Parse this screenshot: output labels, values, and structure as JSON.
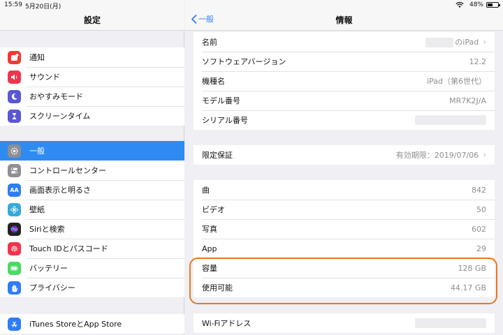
{
  "status": {
    "time": "15:59",
    "date": "5月20日(月)",
    "battery_pct": "48%",
    "battery_level": 0.48
  },
  "sidebar": {
    "title": "設定",
    "groups": [
      [
        {
          "label": "通知",
          "icon": "notifications-icon",
          "color": "#f03b32"
        },
        {
          "label": "サウンド",
          "icon": "sound-icon",
          "color": "#f0344d"
        },
        {
          "label": "おやすみモード",
          "icon": "moon-icon",
          "color": "#5a56d6"
        },
        {
          "label": "スクリーンタイム",
          "icon": "hourglass-icon",
          "color": "#5a56d6"
        }
      ],
      [
        {
          "label": "一般",
          "icon": "gear-icon",
          "color": "#8e8e93",
          "selected": true
        },
        {
          "label": "コントロールセンター",
          "icon": "toggles-icon",
          "color": "#8e8e93"
        },
        {
          "label": "画面表示と明るさ",
          "icon": "text-size-icon",
          "color": "#2f7cf6",
          "glyph": "AA"
        },
        {
          "label": "壁紙",
          "icon": "wallpaper-icon",
          "color": "#35aadc"
        },
        {
          "label": "Siriと検索",
          "icon": "siri-icon",
          "color": "#222222"
        },
        {
          "label": "Touch IDとパスコード",
          "icon": "fingerprint-icon",
          "color": "#f0344d"
        },
        {
          "label": "バッテリー",
          "icon": "battery-icon",
          "color": "#4cd964"
        },
        {
          "label": "プライバシー",
          "icon": "hand-icon",
          "color": "#2f7cf6"
        }
      ],
      [
        {
          "label": "iTunes StoreとApp Store",
          "icon": "app-store-icon",
          "color": "#2f7cf6"
        }
      ]
    ]
  },
  "detail": {
    "back_label": "一般",
    "title": "情報",
    "groups": [
      [
        {
          "label": "名前",
          "value": "のiPad",
          "chevron": true,
          "redacted_prefix": true
        },
        {
          "label": "ソフトウェアバージョン",
          "value": "12.2"
        },
        {
          "label": "機種名",
          "value": "iPad（第6世代）"
        },
        {
          "label": "モデル番号",
          "value": "MR7K2J/A"
        },
        {
          "label": "シリアル番号",
          "value": "",
          "redacted": true
        }
      ],
      [
        {
          "label": "限定保証",
          "value": "有効期限：2019/07/06",
          "chevron": true
        }
      ],
      [
        {
          "label": "曲",
          "value": "842"
        },
        {
          "label": "ビデオ",
          "value": "50"
        },
        {
          "label": "写真",
          "value": "602"
        },
        {
          "label": "App",
          "value": "29"
        },
        {
          "label": "容量",
          "value": "128 GB"
        },
        {
          "label": "使用可能",
          "value": "44.17 GB"
        }
      ],
      [
        {
          "label": "Wi-Fiアドレス",
          "value": "",
          "redacted": true
        }
      ]
    ]
  },
  "colors": {
    "accent": "#2f7cf6",
    "selected_row": "#2f8bf1",
    "highlight": "#e87722"
  }
}
